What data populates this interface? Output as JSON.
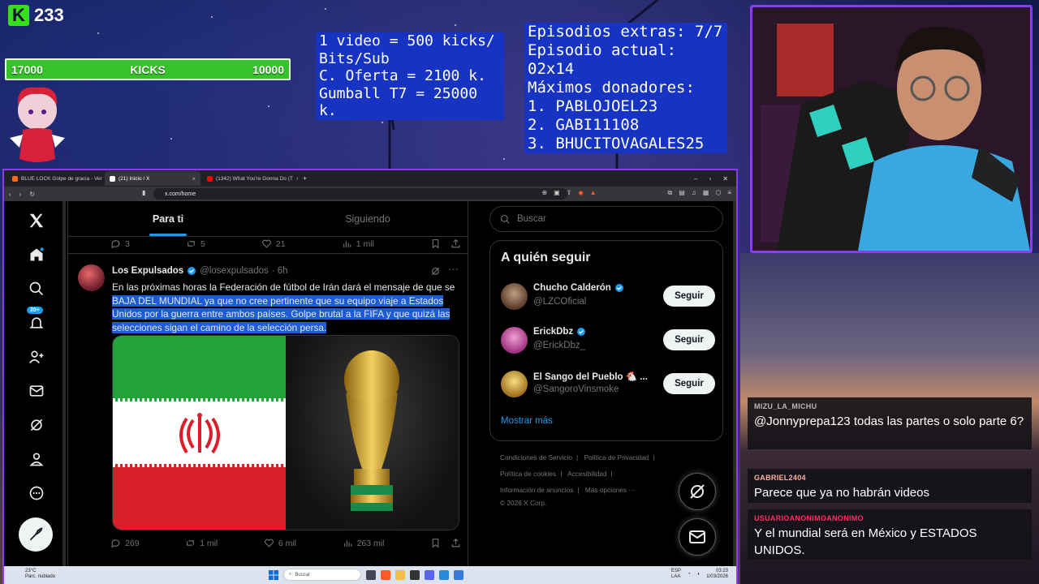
{
  "overlay": {
    "kick_logo": "K",
    "kick_count": "233",
    "kick_bar": {
      "left": "17000",
      "center": "KICKS",
      "right": "10000"
    },
    "box_kicks": [
      "1 video = 500 kicks/",
      "Bits/Sub",
      "C. Oferta = 2100 k.",
      "Gumball T7 = 25000 k."
    ],
    "box_episodes": [
      "Episodios extras: 7/7",
      "Episodio actual: 02x14",
      "Máximos donadores:",
      "1. PABLOJOEL23",
      "2. GABI11108",
      "3. BHUCITOVAGALES25"
    ]
  },
  "chat": [
    {
      "user": "MIZU_LA_MICHU",
      "user_color": "#b8b8b8",
      "text": "@Jonnyprepa123 todas las partes o solo parte 6?"
    },
    {
      "user": "GABRIEL2404",
      "user_color": "#ffb0a0",
      "text": "Parece que ya no habrán videos"
    },
    {
      "user": "USUARIOANONIMOANONIMO",
      "user_color": "#ff3060",
      "text": "Y el mundial será en México y ESTADOS UNIDOS."
    }
  ],
  "browser": {
    "tabs": [
      {
        "title": "BLUE LOCK Golpe de gracia - Ver",
        "favicon_color": "#ff6a1a"
      },
      {
        "title": "(21) Inicio / X",
        "favicon_color": "#ffffff"
      },
      {
        "title": "(1342) What You're Gonna Do (T",
        "favicon_color": "#ff0000"
      }
    ],
    "new_tab": "+",
    "url": "x.com/home"
  },
  "x": {
    "badge_count": "20+",
    "feed_tabs": [
      "Para ti",
      "Siguiendo"
    ],
    "prev_tweet_actions": {
      "replies": "3",
      "reposts": "5",
      "likes": "21",
      "views": "1 mil"
    },
    "tweet": {
      "name": "Los Expulsados",
      "handle": "@losexpulsados",
      "time": "· 6h",
      "text_plain": "En las próximas horas la Federación de fútbol de Irán dará el mensaje de que se ",
      "text_highlight": "BAJA DEL MUNDIAL ya que no cree pertinente que su equipo viaje a Estados Unidos por la guerra entre ambos países. Golpe brutal a la FIFA y que quizá las selecciones sigan el camino de la selección persa.",
      "actions": {
        "replies": "269",
        "reposts": "1 mil",
        "likes": "6 mil",
        "views": "263 mil"
      }
    },
    "search_placeholder": "Buscar",
    "follow_title": "A quién seguir",
    "follow": [
      {
        "name": "Chucho Calderón",
        "handle": "@LZCOficial",
        "verified": true,
        "button": "Seguir",
        "avatar_color": "#8a6a50"
      },
      {
        "name": "ErickDbz",
        "handle": "@ErickDbz_",
        "verified": true,
        "button": "Seguir",
        "avatar_color": "#e05aa8"
      },
      {
        "name": "El Sango del Pueblo 🐔 ...",
        "handle": "@SangoroVinsmoke",
        "verified": false,
        "button": "Seguir",
        "avatar_color": "#d8b040"
      }
    ],
    "show_more": "Mostrar más",
    "footer": {
      "line1": [
        "Condiciones de Servicio",
        "Política de Privacidad"
      ],
      "line2": [
        "Política de cookies",
        "Accesibilidad"
      ],
      "line3": [
        "Información de anuncios",
        "Más opciones ···"
      ],
      "copyright": "© 2026 X Corp."
    }
  },
  "taskbar": {
    "temp": "23°C",
    "weather": "Parc. nublado",
    "search": "Buscar",
    "lang1": "ESP",
    "lang2": "LAA",
    "time": "03:23",
    "date": "1/03/2026"
  },
  "colors": {
    "accent": "#1d9bf0",
    "kick_green": "#35e01a",
    "box_blue": "#1733c2",
    "frame_purple": "#8a3cf0"
  }
}
